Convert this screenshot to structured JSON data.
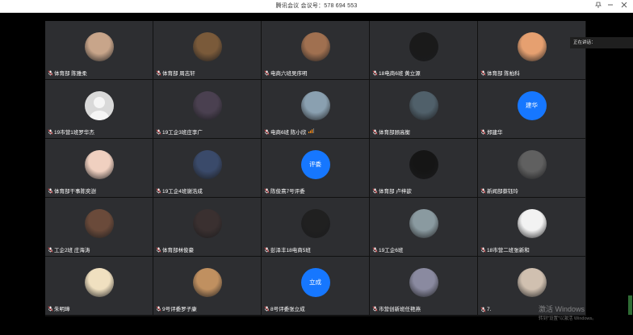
{
  "window": {
    "title": "腾讯会议 会议号：578 694 553",
    "controls": [
      "pin-icon",
      "minimize-icon",
      "close-icon"
    ]
  },
  "speaking_panel": {
    "label": "正在讲话："
  },
  "watermark": {
    "title": "激活 Windows",
    "subtitle": "转到\"设置\"以激活 Windows。"
  },
  "colors": {
    "tile": "#2d2e31",
    "accent": "#1677ff",
    "background": "#000000"
  },
  "participants": [
    {
      "name": "体育部 陈雅柔",
      "avatar": "photo",
      "avatar_bg": "#c8a58a"
    },
    {
      "name": "体育部 周志轩",
      "avatar": "photo",
      "avatar_bg": "#7a5a3a"
    },
    {
      "name": "电商六班吴序明",
      "avatar": "photo",
      "avatar_bg": "#a07050"
    },
    {
      "name": "18电商6班 黄立源",
      "avatar": "photo",
      "avatar_bg": "#1a1a1a"
    },
    {
      "name": "体育部 陈柏科",
      "avatar": "photo",
      "avatar_bg": "#e6a070"
    },
    {
      "name": "19市营1班罗华杰",
      "avatar": "default",
      "avatar_bg": "#d9d9d9"
    },
    {
      "name": "19工企3班庄李广",
      "avatar": "photo",
      "avatar_bg": "#4a4050"
    },
    {
      "name": "电商6班 陈小欣",
      "avatar": "photo",
      "avatar_bg": "#8aa0b0",
      "signal": true
    },
    {
      "name": "体育部顾高衡",
      "avatar": "photo",
      "avatar_bg": "#50606a"
    },
    {
      "name": "郑建华",
      "avatar": "text",
      "avatar_text": "建华"
    },
    {
      "name": "体育部干事陈奕澍",
      "avatar": "photo",
      "avatar_bg": "#f0d0c0"
    },
    {
      "name": "19工企4班谢浩成",
      "avatar": "photo",
      "avatar_bg": "#3a4a6a"
    },
    {
      "name": "陈俊熹7号评委",
      "avatar": "text",
      "avatar_text": "评委"
    },
    {
      "name": "体育部 卢梓歆",
      "avatar": "photo",
      "avatar_bg": "#151515"
    },
    {
      "name": "新闻部蔡钰玲",
      "avatar": "photo",
      "avatar_bg": "#606060"
    },
    {
      "name": "工企2班 庄海涛",
      "avatar": "photo",
      "avatar_bg": "#6a4a3a"
    },
    {
      "name": "体育部林俊豪",
      "avatar": "photo",
      "avatar_bg": "#3a3030"
    },
    {
      "name": "彭泽丰18电商5班",
      "avatar": "photo",
      "avatar_bg": "#202020"
    },
    {
      "name": "19工企6班",
      "avatar": "photo",
      "avatar_bg": "#8a9aa0"
    },
    {
      "name": "18市营二班张新和",
      "avatar": "photo",
      "avatar_bg": "#f2f2f2"
    },
    {
      "name": "朱明璋",
      "avatar": "photo",
      "avatar_bg": "#f0e0c0"
    },
    {
      "name": "9号评委罗子康",
      "avatar": "photo",
      "avatar_bg": "#c09060"
    },
    {
      "name": "8号评委张立成",
      "avatar": "text",
      "avatar_text": "立成"
    },
    {
      "name": "市营创新班任艳燕",
      "avatar": "photo",
      "avatar_bg": "#8a8aa0"
    },
    {
      "name": "7.",
      "avatar": "photo",
      "avatar_bg": "#d0c0b0"
    }
  ]
}
